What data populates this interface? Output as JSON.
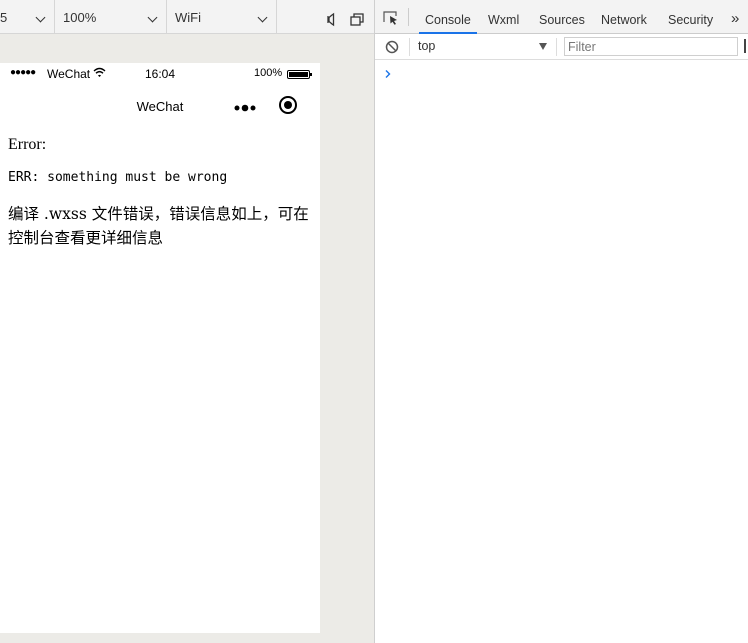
{
  "simulator": {
    "toolbar": {
      "device_value": "5",
      "zoom_value": "100%",
      "network_value": "WiFi"
    },
    "statusbar": {
      "signal": "●●●●●",
      "carrier": "WeChat",
      "time": "16:04",
      "battery_pct": "100%"
    },
    "navbar": {
      "title": "WeChat"
    },
    "page": {
      "error_title": "Error:",
      "error_code": "ERR: something must be wrong",
      "error_desc": "编译 .wxss 文件错误，错误信息如上，可在控制台查看更详细信息"
    }
  },
  "devtools": {
    "tabs": [
      {
        "label": "Console",
        "active": true
      },
      {
        "label": "Wxml",
        "active": false
      },
      {
        "label": "Sources",
        "active": false
      },
      {
        "label": "Network",
        "active": false
      },
      {
        "label": "Security",
        "active": false
      }
    ],
    "more_tabs": "»",
    "console": {
      "context": "top",
      "filter_placeholder": "Filter",
      "prompt": "›"
    },
    "accent": "#1a73e8"
  },
  "icons": [
    "chevron-down-icon",
    "speaker-icon",
    "window-icon",
    "wifi-icon",
    "battery-icon",
    "more-dots-icon",
    "close-circle-icon",
    "inspect-icon",
    "clear-console-icon",
    "console-prompt-icon"
  ]
}
